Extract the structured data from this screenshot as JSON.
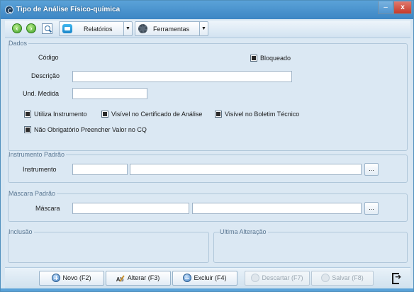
{
  "window": {
    "title": "Tipo de Análise Físico-química",
    "minimize_label": "–",
    "close_label": "x"
  },
  "toolbar": {
    "relatorios_label": "Relatórios",
    "ferramentas_label": "Ferramentas"
  },
  "dados": {
    "title": "Dados",
    "codigo_label": "Código",
    "bloqueado_label": "Bloqueado",
    "bloqueado_checked": true,
    "descricao_label": "Descrição",
    "descricao_value": "",
    "und_medida_label": "Und. Medida",
    "und_medida_value": "",
    "checkboxes": [
      {
        "label": "Utiliza Instrumento",
        "checked": true
      },
      {
        "label": "Visível no Certificado de Análise",
        "checked": true
      },
      {
        "label": "Visível no Boletim Técnico",
        "checked": true
      },
      {
        "label": "Não Obrigatório Preencher Valor no CQ",
        "checked": true
      }
    ]
  },
  "instrumento": {
    "title": "Instrumento Padrão",
    "label": "Instrumento",
    "code_value": "",
    "desc_value": "",
    "lookup_label": "..."
  },
  "mascara": {
    "title": "Máscara Padrão",
    "label": "Máscara",
    "code_value": "",
    "desc_value": "",
    "lookup_label": "..."
  },
  "inclusao": {
    "title": "Inclusão"
  },
  "ultima_alteracao": {
    "title": "Ultima Alteração"
  },
  "footer": {
    "novo_label": "Novo (F2)",
    "alterar_label": "Alterar (F3)",
    "excluir_label": "Excluir (F4)",
    "descartar_label": "Descartar (F7)",
    "salvar_label": "Salvar (F8)"
  },
  "colors": {
    "title_bar": "#3d86c4",
    "panel_bg": "#dbe8f3",
    "group_title": "#5b7893",
    "disabled_text": "#9aa6b0"
  }
}
